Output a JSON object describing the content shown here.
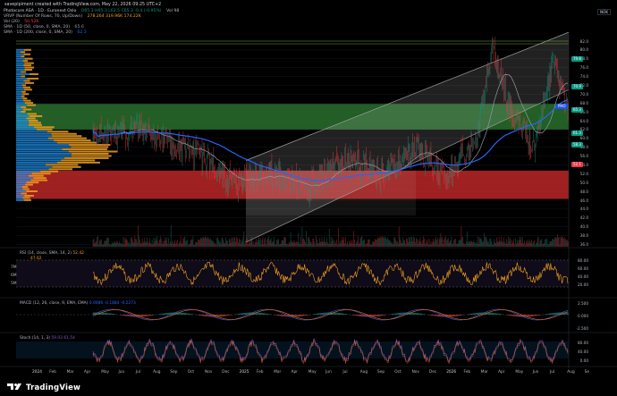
{
  "credit": "savepipiment created with TradingView.com, May 22, 2026 09:25 UTC+2",
  "currency_button": "NOK",
  "header": {
    "symbol_line": "Photocure ASA · 1D · Euronext Oslo",
    "ohlc": "O65.3 H65.3 L63.5 C65.3 -0.4 (-0.95%)",
    "vol_tag": "Vol 98",
    "vrvp_label": "VRVP (Number Of Rows, 70, Up/Down)",
    "vrvp_values": "278.264   319.96K   174.22K",
    "vol20_label": "Vol (20)",
    "vol20_value": "50.52K",
    "sma50_label": "SMA · 1D (50, close, 0, SMA, 20)",
    "sma50_value": "65.6",
    "sma200_label": "SMA · 1D (200, close, 0, SMA, 20)",
    "sma200_value": "62.3"
  },
  "y_axis": {
    "ticks": [
      "82.0",
      "80.0",
      "78.0",
      "76.0",
      "74.0",
      "72.0",
      "70.0",
      "68.0",
      "66.0",
      "64.0",
      "62.0",
      "60.0",
      "58.0",
      "56.0",
      "54.0",
      "52.0",
      "50.0",
      "48.0",
      "46.0",
      "44.0",
      "42.0",
      "40.0",
      "38.0",
      "36.0"
    ],
    "price_tags": [
      {
        "text": "PHO",
        "color": "#1e53e5"
      },
      {
        "text": "65.3",
        "color": "#089981"
      },
      {
        "text": "79.8",
        "color": "#089981"
      },
      {
        "text": "70.9",
        "color": "#089981"
      },
      {
        "text": "61.3",
        "color": "#089981"
      },
      {
        "text": "58.3",
        "color": "#089981"
      },
      {
        "text": "52.1",
        "color": "#f23645"
      }
    ]
  },
  "x_axis": {
    "labels": [
      "2024",
      "Feb",
      "Mar",
      "Apr",
      "May",
      "Jun",
      "Jul",
      "Aug",
      "Sep",
      "Oct",
      "Nov",
      "Dec",
      "2025",
      "Feb",
      "Mar",
      "Apr",
      "May",
      "Jun",
      "Jul",
      "Aug",
      "Sep",
      "Oct",
      "Nov",
      "Dec",
      "2026",
      "Feb",
      "Mar",
      "Apr",
      "May",
      "Jun",
      "Jul",
      "Aug",
      "Se"
    ]
  },
  "rsi": {
    "label": "RSI (14, close, SMA, 14, 2)",
    "value": "52.42",
    "value2": "47.62",
    "side_ticks": [
      "7M",
      "6M",
      "5M"
    ],
    "axis_ticks": [
      "80.00",
      "60.00",
      "40.00",
      "20.00"
    ]
  },
  "macd": {
    "label": "MACD (12, 26, close, 9, EMA, EMA)",
    "values": "0.0086  -0.1884  -0.2273",
    "axis_ticks": [
      "2.500",
      "0.000",
      "-2.500"
    ]
  },
  "stoch": {
    "label": "Stoch (14, 1, 3)",
    "values": "59.03  61.54",
    "axis_ticks": [
      "80.00",
      "40.00",
      "0.00"
    ]
  },
  "brand": "TradingView",
  "colors": {
    "green_zone": "#2e7d32",
    "red_zone": "#c62828",
    "channel": "#9e9e9e",
    "sma50": "#9598a1",
    "sma200": "#2962ff",
    "candle_up": "#089981",
    "candle_down": "#f23645",
    "volume_profile_up": "#f0a020",
    "volume_profile_down": "#2196f3",
    "rsi_line": "#f0a020",
    "stoch_k": "#7e57c2"
  }
}
